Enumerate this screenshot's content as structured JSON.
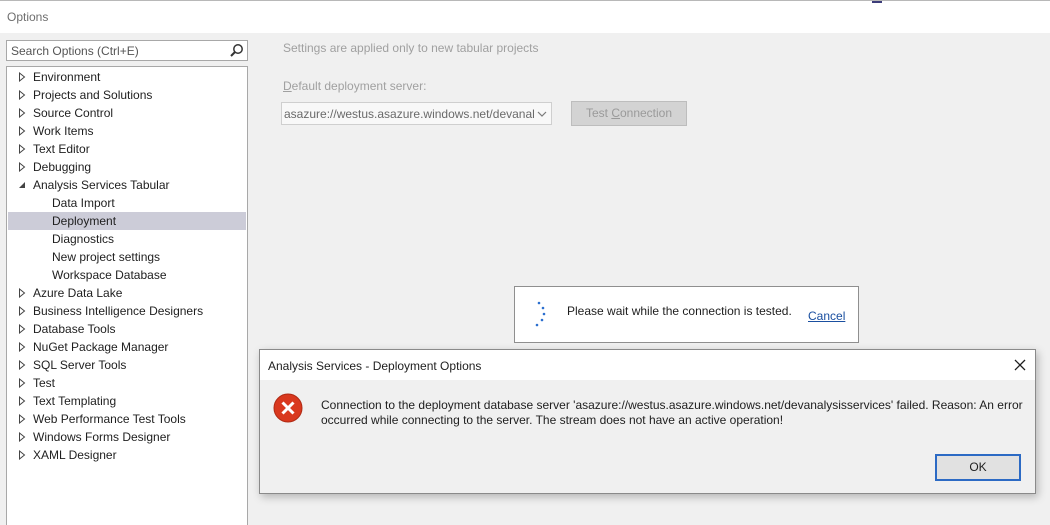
{
  "window": {
    "title": "Options"
  },
  "search": {
    "placeholder": "Search Options (Ctrl+E)",
    "icon": "search-icon"
  },
  "tree": {
    "items": [
      {
        "label": "Environment",
        "expanded": false,
        "level": 0
      },
      {
        "label": "Projects and Solutions",
        "expanded": false,
        "level": 0
      },
      {
        "label": "Source Control",
        "expanded": false,
        "level": 0
      },
      {
        "label": "Work Items",
        "expanded": false,
        "level": 0
      },
      {
        "label": "Text Editor",
        "expanded": false,
        "level": 0
      },
      {
        "label": "Debugging",
        "expanded": false,
        "level": 0
      },
      {
        "label": "Analysis Services Tabular",
        "expanded": true,
        "level": 0
      },
      {
        "label": "Data Import",
        "level": 1
      },
      {
        "label": "Deployment",
        "level": 1,
        "selected": true
      },
      {
        "label": "Diagnostics",
        "level": 1
      },
      {
        "label": "New project settings",
        "level": 1
      },
      {
        "label": "Workspace Database",
        "level": 1
      },
      {
        "label": "Azure Data Lake",
        "expanded": false,
        "level": 0
      },
      {
        "label": "Business Intelligence Designers",
        "expanded": false,
        "level": 0
      },
      {
        "label": "Database Tools",
        "expanded": false,
        "level": 0
      },
      {
        "label": "NuGet Package Manager",
        "expanded": false,
        "level": 0
      },
      {
        "label": "SQL Server Tools",
        "expanded": false,
        "level": 0
      },
      {
        "label": "Test",
        "expanded": false,
        "level": 0
      },
      {
        "label": "Text Templating",
        "expanded": false,
        "level": 0
      },
      {
        "label": "Web Performance Test Tools",
        "expanded": false,
        "level": 0
      },
      {
        "label": "Windows Forms Designer",
        "expanded": false,
        "level": 0
      },
      {
        "label": "XAML Designer",
        "expanded": false,
        "level": 0
      }
    ]
  },
  "content": {
    "note": "Settings are applied only to new tabular projects",
    "server_label_first": "D",
    "server_label_rest": "efault deployment server:",
    "server_value": "asazure://westus.asazure.windows.net/devanalysisservices",
    "test_button_pre": "Test ",
    "test_button_ul": "C",
    "test_button_post": "onnection"
  },
  "wait": {
    "message": "Please wait while the connection is tested.",
    "cancel": "Cancel"
  },
  "dialog": {
    "title": "Analysis Services - Deployment Options",
    "message": "Connection to the deployment database server 'asazure://westus.asazure.windows.net/devanalysisservices' failed. Reason: An error occurred while connecting to the server. The stream does not have an active operation!",
    "ok": "OK"
  },
  "colors": {
    "selection": "#ccccd8",
    "error_red": "#d9381e",
    "ok_border": "#2c6ac4",
    "link": "#1a4fa0"
  }
}
